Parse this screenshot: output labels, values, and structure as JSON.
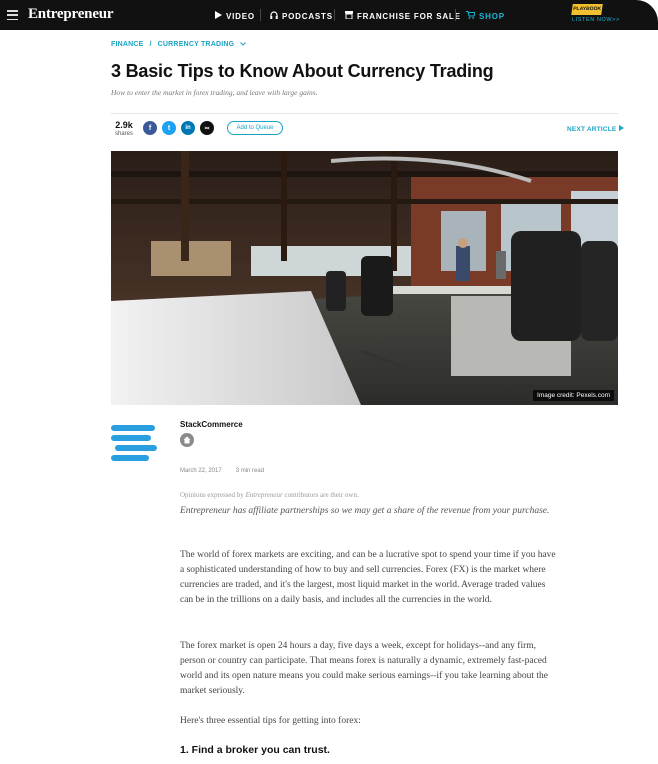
{
  "nav": {
    "brand": "Entrepreneur",
    "items": [
      {
        "label": "VIDEO",
        "icon": "play-icon"
      },
      {
        "label": "PODCASTS",
        "icon": "headphones-icon"
      },
      {
        "label": "FRANCHISE FOR SALE",
        "icon": "storefront-icon"
      },
      {
        "label": "SHOP",
        "icon": "cart-icon"
      }
    ],
    "shop_color": "#1fb5d6",
    "playbook_badge": "PLAYBOOK",
    "playbook_listen": "LISTEN NOW>>"
  },
  "breadcrumb": {
    "section": "FINANCE",
    "separator": "/",
    "topic": "CURRENCY TRADING"
  },
  "article": {
    "title": "3 Basic Tips to Know About Currency Trading",
    "subtitle": "How to enter the market in forex trading, and leave with large gains.",
    "share_count": "2.9k",
    "share_label": "shares",
    "social": [
      {
        "name": "facebook",
        "glyph": "f",
        "color": "#3b5998"
      },
      {
        "name": "twitter",
        "glyph": "t",
        "color": "#1da1f2"
      },
      {
        "name": "linkedin",
        "glyph": "in",
        "color": "#0077b5"
      },
      {
        "name": "copy-link",
        "glyph": "∞",
        "color": "#111111"
      }
    ],
    "queue_label": "Add to Queue",
    "next_label": "NEXT ARTICLE",
    "image_credit": "Image credit: Pexels.com",
    "author": "StackCommerce",
    "date": "March 22, 2017",
    "read_time": "3 min read",
    "disclaimer_prefix": "Opinions expressed by ",
    "disclaimer_brand": "Entrepreneur",
    "disclaimer_suffix": " contributors are their own.",
    "affiliate": "Entrepreneur has affiliate partnerships so we may get a share of the revenue from your purchase.",
    "paragraphs": [
      "The world of forex markets are exciting, and can be a lucrative spot to spend your time if you have a sophisticated understanding of how to buy and sell currencies. Forex (FX) is the market where currencies are traded, and it's the largest, most liquid market in the world. Average traded values can be in the trillions on a daily basis, and includes all the currencies in the world.",
      "The forex market is open 24 hours a day, five days a week, except for holidays--and any firm, person or country can participate. That means forex is naturally a dynamic, extremely fast-paced world and its open nature means you could make serious earnings--if you take learning about the market seriously.",
      "Here's three essential tips for getting into forex:"
    ],
    "heading_1": "1. Find a broker you can trust."
  },
  "colors": {
    "accent": "#1aa3c4",
    "nav_bg": "#111111",
    "author_logo": "#2a9fe0"
  }
}
